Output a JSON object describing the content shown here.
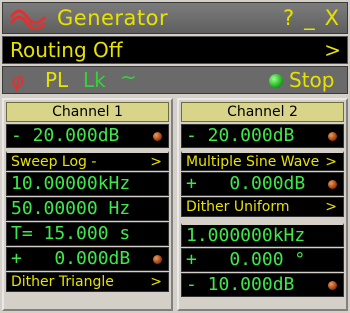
{
  "title_bar": {
    "title": "Generator",
    "help": "?",
    "minimize": "_",
    "close": "X"
  },
  "routing": {
    "label": "Routing Off",
    "arrow": ">"
  },
  "status": {
    "phase_symbol": "φ",
    "pl": "PL",
    "lk": "Lk",
    "tilde": "~",
    "stop": "Stop"
  },
  "channel1": {
    "header": "Channel 1",
    "level": "- 20.000dB",
    "sweep": "Sweep Log -",
    "sweep_arrow": ">",
    "freq_start": "10.00000kHz",
    "freq_stop": "50.00000 Hz",
    "time": "T= 15.000 s",
    "offset": "+   0.000dB",
    "dither": "Dither Triangle",
    "dither_arrow": ">"
  },
  "channel2": {
    "header": "Channel 2",
    "level": "- 20.000dB",
    "waveform": "Multiple Sine Wave",
    "waveform_arrow": ">",
    "offset": "+   0.000dB",
    "dither": "Dither Uniform",
    "dither_arrow": ">",
    "frequency": "1.000000kHz",
    "phase": "+   0.000 °",
    "level2": "- 10.000dB"
  },
  "colors": {
    "accent_yellow": "#e7e200",
    "value_green": "#3ee84a",
    "status_red": "#e23030"
  }
}
